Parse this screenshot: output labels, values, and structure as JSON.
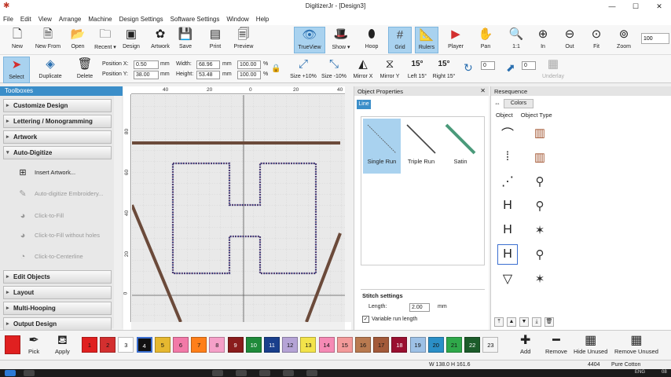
{
  "window": {
    "title": "DigitizerJr - [Design3]"
  },
  "menu": [
    "File",
    "Edit",
    "View",
    "Arrange",
    "Machine",
    "Design Settings",
    "Software Settings",
    "Window",
    "Help"
  ],
  "toolbar_main": [
    {
      "id": "new",
      "label": "New",
      "icon": "new-document-icon",
      "glyph": "🗋"
    },
    {
      "id": "new-from",
      "label": "New From",
      "icon": "new-from-icon",
      "glyph": "🗎"
    },
    {
      "id": "open",
      "label": "Open",
      "icon": "folder-icon",
      "glyph": "📂"
    },
    {
      "id": "recent",
      "label": "Recent ▾",
      "icon": "recent-icon",
      "glyph": "🗀"
    },
    {
      "id": "design",
      "label": "Design",
      "icon": "design-icon",
      "glyph": "▣"
    },
    {
      "id": "artwork",
      "label": "Artwork",
      "icon": "artwork-icon",
      "glyph": "✿"
    },
    {
      "id": "save",
      "label": "Save",
      "icon": "save-icon",
      "glyph": "💾"
    },
    {
      "id": "print",
      "label": "Print",
      "icon": "print-icon",
      "glyph": "▤"
    },
    {
      "id": "preview",
      "label": "Preview",
      "icon": "preview-icon",
      "glyph": "🗐"
    },
    {
      "id": "trueview",
      "label": "TrueView",
      "icon": "eye-icon",
      "glyph": "👁"
    },
    {
      "id": "show",
      "label": "Show ▾",
      "icon": "show-icon",
      "glyph": "🎩"
    },
    {
      "id": "hoop",
      "label": "Hoop",
      "icon": "hoop-icon",
      "glyph": "⬮"
    },
    {
      "id": "grid",
      "label": "Grid",
      "icon": "grid-icon",
      "glyph": "#"
    },
    {
      "id": "rulers",
      "label": "Rulers",
      "icon": "rulers-icon",
      "glyph": "📐"
    },
    {
      "id": "player",
      "label": "Player",
      "icon": "play-icon",
      "glyph": "▶"
    },
    {
      "id": "pan",
      "label": "Pan",
      "icon": "hand-icon",
      "glyph": "✋"
    },
    {
      "id": "zoom-1-1",
      "label": "1:1",
      "icon": "zoom-actual-icon",
      "glyph": "🔍"
    },
    {
      "id": "zoom-in",
      "label": "In",
      "icon": "zoom-in-icon",
      "glyph": "⊕"
    },
    {
      "id": "zoom-out",
      "label": "Out",
      "icon": "zoom-out-icon",
      "glyph": "⊖"
    },
    {
      "id": "fit",
      "label": "Fit",
      "icon": "zoom-fit-icon",
      "glyph": "⊙"
    },
    {
      "id": "zoom",
      "label": "Zoom",
      "icon": "zoom-icon",
      "glyph": "⊚"
    }
  ],
  "zoom_value": "100",
  "toolbar_edit": {
    "select": "Select",
    "duplicate": "Duplicate",
    "delete": "Delete",
    "position_x_label": "Position X:",
    "position_x": "0.50",
    "position_y_label": "Position Y:",
    "position_y": "38.00",
    "width_label": "Width:",
    "width": "68.96",
    "height_label": "Height:",
    "height": "53.48",
    "unit": "mm",
    "width_pct": "100.00",
    "height_pct": "100.00",
    "pct": "%",
    "size_up": "Size +10%",
    "size_down": "Size -10%",
    "mirror_x": "Mirror X",
    "mirror_y": "Mirror Y",
    "left_15": "Left 15°",
    "right_15": "Right 15°",
    "rotate_value": "0",
    "skew_value": "0",
    "underlay": "Underlay",
    "fifteen": "15°"
  },
  "toolbox": {
    "header": "Toolboxes",
    "categories": [
      "Customize Design",
      "Lettering / Monogramming",
      "Artwork",
      "Auto-Digitize"
    ],
    "tools": [
      {
        "label": "Insert Artwork...",
        "enabled": true
      },
      {
        "label": "Auto-digitize Embroidery...",
        "enabled": false
      },
      {
        "label": "Click-to-Fill",
        "enabled": false
      },
      {
        "label": "Click-to-Fill without holes",
        "enabled": false
      },
      {
        "label": "Click-to-Centerline",
        "enabled": false
      }
    ],
    "categories_bottom": [
      "Edit Objects",
      "Layout",
      "Multi-Hooping",
      "Output Design"
    ]
  },
  "rulers": {
    "h": [
      "40",
      "20",
      "0",
      "20",
      "40"
    ],
    "v": [
      "80",
      "60",
      "40",
      "20",
      "0"
    ]
  },
  "object_properties": {
    "title": "Object Properties",
    "tab": "Line",
    "stitch_types": [
      "Single Run",
      "Triple Run",
      "Satin"
    ],
    "settings_title": "Stitch settings",
    "length_label": "Length:",
    "length_value": "2.00",
    "length_unit": "mm",
    "variable_run": "Variable run length"
  },
  "resequence": {
    "title": "Resequence",
    "colors_tab": "Colors",
    "col_object": "Object",
    "col_type": "Object Type"
  },
  "palette": {
    "pick": "Pick",
    "apply": "Apply",
    "swatches": [
      {
        "n": "1",
        "c": "#e02020"
      },
      {
        "n": "2",
        "c": "#d32f2f"
      },
      {
        "n": "3",
        "c": "#ffffff"
      },
      {
        "n": "4",
        "c": "#111111"
      },
      {
        "n": "5",
        "c": "#e6b830"
      },
      {
        "n": "6",
        "c": "#f27aa8"
      },
      {
        "n": "7",
        "c": "#ff7f1a"
      },
      {
        "n": "8",
        "c": "#f5a0c8"
      },
      {
        "n": "9",
        "c": "#8a1c1c"
      },
      {
        "n": "10",
        "c": "#1f8a3a"
      },
      {
        "n": "11",
        "c": "#1a3f8c"
      },
      {
        "n": "12",
        "c": "#b5a3d6"
      },
      {
        "n": "13",
        "c": "#f3e34a"
      },
      {
        "n": "14",
        "c": "#f58ab5"
      },
      {
        "n": "15",
        "c": "#f39a9a"
      },
      {
        "n": "16",
        "c": "#b97a50"
      },
      {
        "n": "17",
        "c": "#a35a3a"
      },
      {
        "n": "18",
        "c": "#9a1030"
      },
      {
        "n": "19",
        "c": "#9dc1e6"
      },
      {
        "n": "20",
        "c": "#2b8fc7"
      },
      {
        "n": "21",
        "c": "#2fa84a"
      },
      {
        "n": "22",
        "c": "#1c5c2a"
      },
      {
        "n": "23",
        "c": "#f4f4f4"
      }
    ],
    "add": "Add",
    "remove": "Remove",
    "hide_unused": "Hide Unused",
    "remove_unused": "Remove Unused"
  },
  "status": {
    "dims": "W 138.0 H 161.6",
    "stitches": "4404",
    "thread": "Pure Cotton"
  },
  "taskbar": {
    "lang": "ENG",
    "time": "08"
  },
  "colors": {
    "accent": "#3b8ec9",
    "active": "#a9d2ef"
  }
}
